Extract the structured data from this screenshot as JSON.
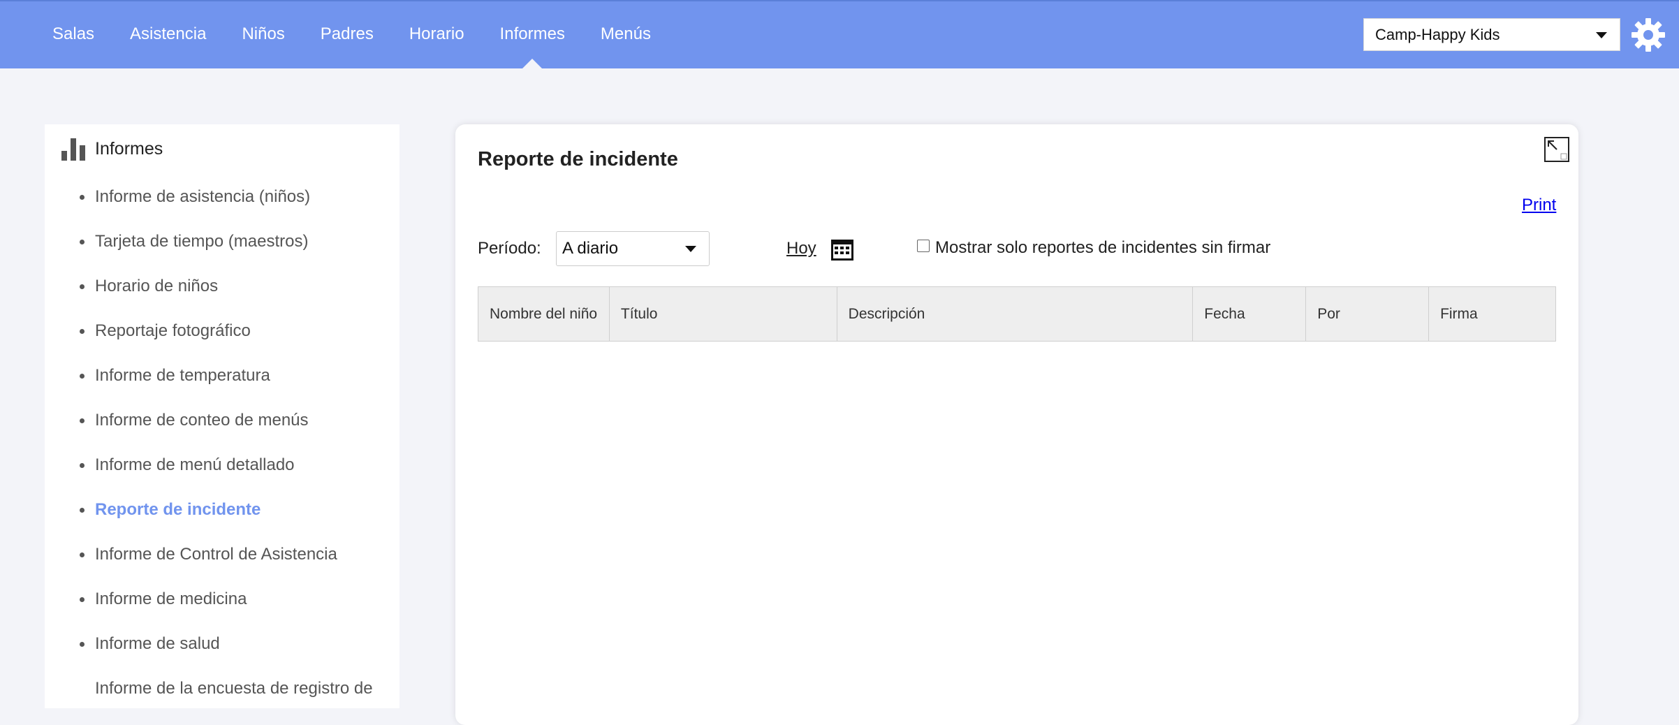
{
  "nav": {
    "items": [
      "Salas",
      "Asistencia",
      "Niños",
      "Padres",
      "Horario",
      "Informes",
      "Menús"
    ],
    "active": "Informes",
    "center_select": "Camp-Happy Kids"
  },
  "sidebar": {
    "title": "Informes",
    "items": [
      {
        "label": "Informe de asistencia (niños)"
      },
      {
        "label": "Tarjeta de tiempo (maestros)"
      },
      {
        "label": "Horario de niños"
      },
      {
        "label": "Reportaje fotográfico"
      },
      {
        "label": "Informe de temperatura"
      },
      {
        "label": "Informe de conteo de menús"
      },
      {
        "label": "Informe de menú detallado"
      },
      {
        "label": "Reporte de incidente"
      },
      {
        "label": "Informe de Control de Asistencia"
      },
      {
        "label": "Informe de medicina"
      },
      {
        "label": "Informe de salud"
      },
      {
        "label": "Informe de la encuesta de registro de"
      }
    ],
    "active": "Reporte de incidente"
  },
  "report": {
    "title": "Reporte de incidente",
    "print_label": "Print",
    "period_label": "Período:",
    "period_value": "A diario",
    "today_label": "Hoy",
    "unsigned_only_label": "Mostrar solo reportes de incidentes sin firmar",
    "unsigned_only_checked": false,
    "columns": [
      "Nombre del niño",
      "Título",
      "Descripción",
      "Fecha",
      "Por",
      "Firma"
    ]
  },
  "colors": {
    "topbar": "#7194ee",
    "active_link": "#7194ee",
    "background": "#f3f4f9"
  }
}
